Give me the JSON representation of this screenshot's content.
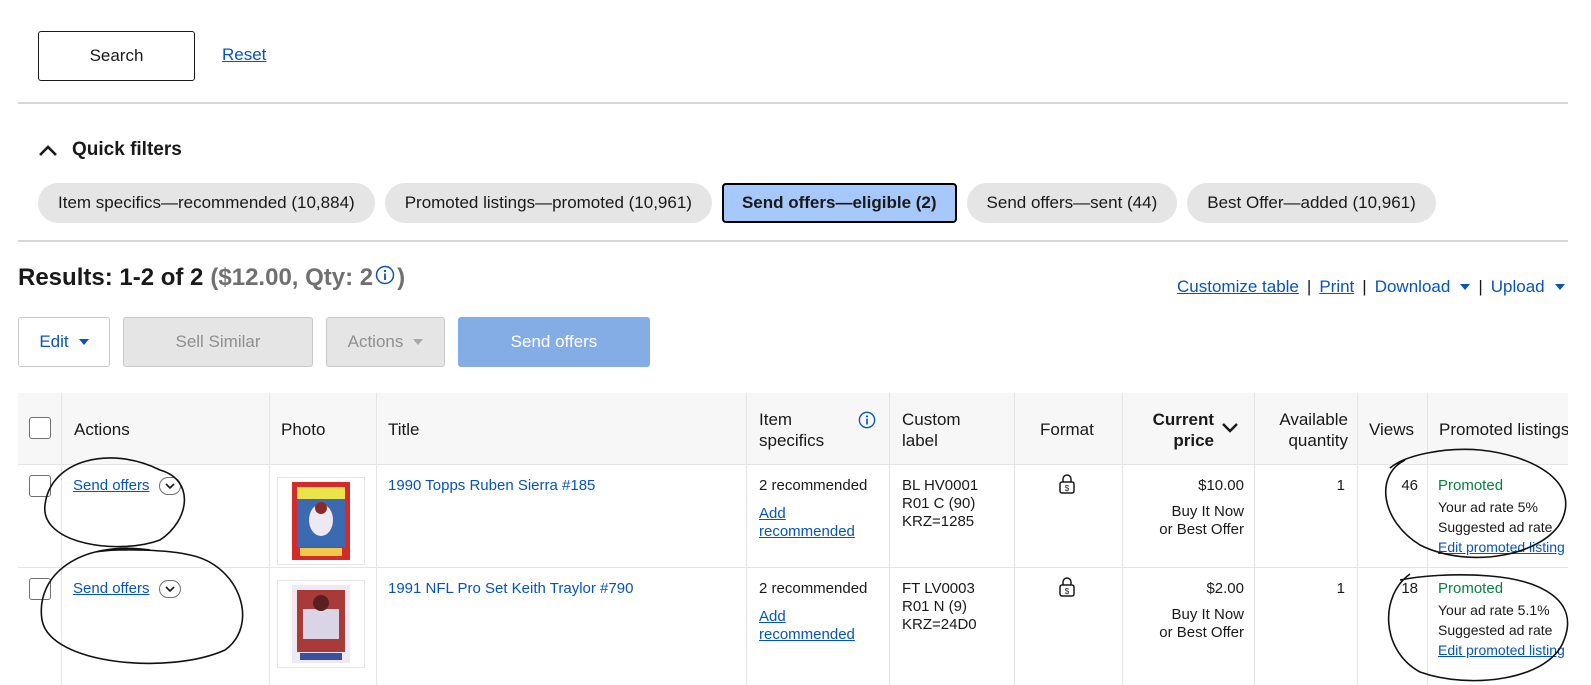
{
  "search_bar": {
    "search_label": "Search",
    "reset_label": "Reset"
  },
  "quick_filters": {
    "title": "Quick filters",
    "chips": [
      {
        "label": "Item specifics—recommended (10,884)"
      },
      {
        "label": "Promoted listings—promoted (10,961)"
      },
      {
        "label": "Send offers—eligible (2)",
        "active": true
      },
      {
        "label": "Send offers—sent (44)"
      },
      {
        "label": "Best Offer—added (10,961)"
      }
    ]
  },
  "results": {
    "label": "Results: 1-2 of 2",
    "summary_open": "($12.00, Qty: 2",
    "summary_close": ")"
  },
  "toplinks": {
    "customize": "Customize table",
    "print": "Print",
    "download": "Download",
    "upload": "Upload"
  },
  "toolbar": {
    "edit": "Edit",
    "sell_similar": "Sell Similar",
    "actions": "Actions",
    "send_offers": "Send offers"
  },
  "table": {
    "headers": {
      "actions": "Actions",
      "photo": "Photo",
      "title": "Title",
      "item_specifics_1": "Item",
      "item_specifics_2": "specifics",
      "custom_label_1": "Custom",
      "custom_label_2": "label",
      "format": "Format",
      "current_price_1": "Current",
      "current_price_2": "price",
      "available_qty_1": "Available",
      "available_qty_2": "quantity",
      "views": "Views",
      "promoted": "Promoted listings"
    },
    "rows": [
      {
        "action": "Send offers",
        "title": "1990 Topps Ruben Sierra #185",
        "specifics": "2 recommended",
        "add_rec_1": "Add",
        "add_rec_2": "recommended",
        "label_1": "BL HV0001",
        "label_2": "R01 C (90)",
        "label_3": "KRZ=1285",
        "price": "$10.00",
        "format_1": "Buy It Now",
        "format_2": "or Best Offer",
        "qty": "1",
        "views": "46",
        "promo_status": "Promoted",
        "ad_rate": "Your ad rate 5%",
        "suggested": "Suggested ad rate",
        "edit_promo": "Edit promoted listing"
      },
      {
        "action": "Send offers",
        "title": "1991 NFL Pro Set Keith Traylor #790",
        "specifics": "2 recommended",
        "add_rec_1": "Add",
        "add_rec_2": "recommended",
        "label_1": "FT LV0003",
        "label_2": "R01 N (9)",
        "label_3": "KRZ=24D0",
        "price": "$2.00",
        "format_1": "Buy It Now",
        "format_2": "or Best Offer",
        "qty": "1",
        "views": "18",
        "promo_status": "Promoted",
        "ad_rate": "Your ad rate 5.1%",
        "suggested": "Suggested ad rate",
        "edit_promo": "Edit promoted listing"
      }
    ]
  }
}
